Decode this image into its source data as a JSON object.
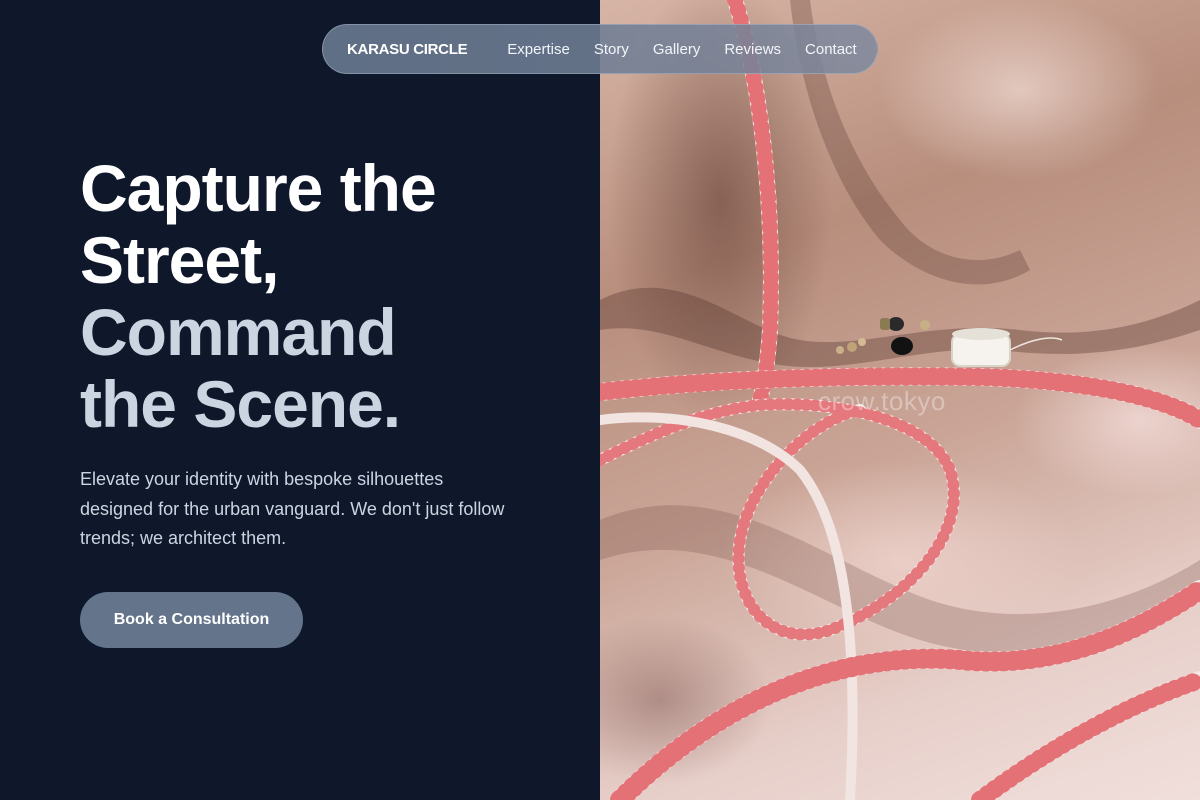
{
  "nav": {
    "brand": "KARASU CIRCLE",
    "links": [
      "Expertise",
      "Story",
      "Gallery",
      "Reviews",
      "Contact"
    ]
  },
  "hero": {
    "title_line1": "Capture the",
    "title_line2": "Street,",
    "title_line3": "Command",
    "title_line4": "the Scene.",
    "description": "Elevate your identity with bespoke silhouettes designed for the urban vanguard. We don't just follow trends; we architect them.",
    "cta_label": "Book a Consultation"
  },
  "image": {
    "watermark": "crow.tokyo",
    "subject": "silk-fabric-with-measuring-tape-photo"
  },
  "colors": {
    "background": "#0f172a",
    "accent": "#64748b",
    "title_primary": "#ffffff",
    "title_secondary": "#cbd5e1",
    "tape": "#f3e9e6",
    "tape_marks": "#e0525a"
  }
}
